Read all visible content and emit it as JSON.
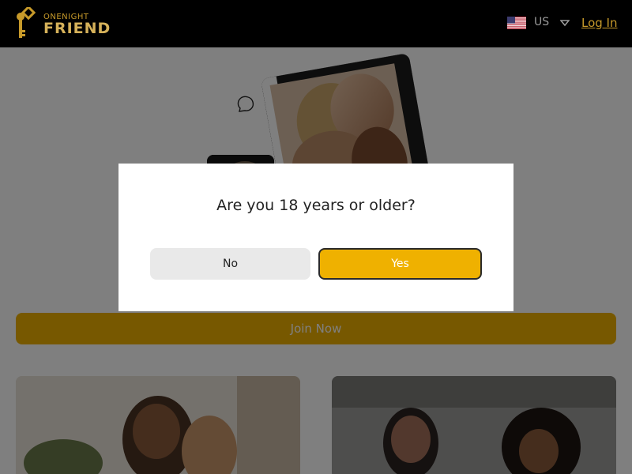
{
  "header": {
    "logo_top": "ONENIGHT",
    "logo_main": "FRIEND",
    "country": "US",
    "login_label": "Log In"
  },
  "hero": {
    "join_label": "Join Now"
  },
  "modal": {
    "question": "Are you 18 years or older?",
    "no_label": "No",
    "yes_label": "Yes"
  },
  "colors": {
    "brand_gold": "#efb100",
    "header_bg": "#000000",
    "overlay": "rgba(0,0,0,0.5)"
  },
  "icons": [
    "logo-key-icon",
    "us-flag-icon",
    "chevron-down-icon",
    "chat-bubble-icon"
  ]
}
